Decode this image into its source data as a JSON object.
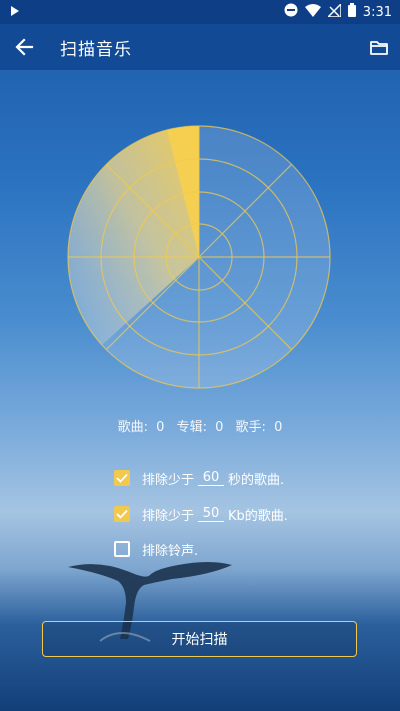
{
  "status_bar": {
    "time": "3:31",
    "icons": [
      "play-icon",
      "do-not-disturb-icon",
      "wifi-icon",
      "no-signal-icon",
      "battery-icon"
    ]
  },
  "app_bar": {
    "title": "扫描音乐",
    "back_icon": "back-arrow-icon",
    "folder_icon": "folder-icon"
  },
  "stats": {
    "songs_label": "歌曲:",
    "songs_count": "0",
    "albums_label": "专辑:",
    "albums_count": "0",
    "artists_label": "歌手:",
    "artists_count": "0"
  },
  "options": [
    {
      "checked": true,
      "prefix": "排除少于",
      "value": "60",
      "suffix": "秒的歌曲."
    },
    {
      "checked": true,
      "prefix": "排除少于",
      "value": "50",
      "suffix": "Kb的歌曲."
    },
    {
      "checked": false,
      "label": "排除铃声."
    }
  ],
  "scan_button": {
    "label": "开始扫描"
  },
  "colors": {
    "accent": "#f2c94c",
    "status_bar": "#0e3f86",
    "app_bar": "#124a95",
    "text": "#ffffff"
  }
}
